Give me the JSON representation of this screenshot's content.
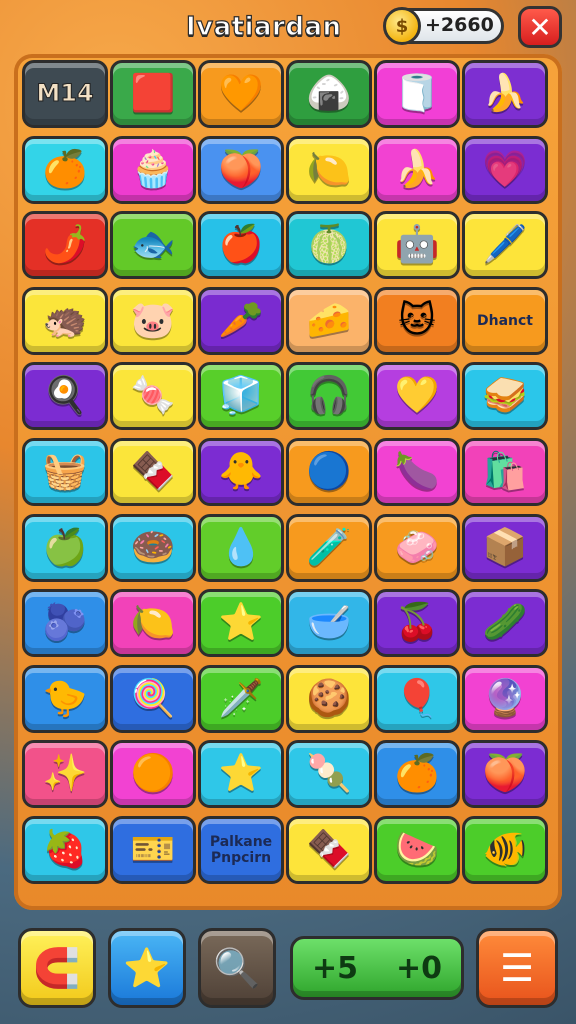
{
  "header": {
    "title": "Ivatiardan",
    "coins": "+2660",
    "coin_symbol": "$",
    "close_symbol": "✕"
  },
  "colors": {
    "board": "#f09a35",
    "close": "#e0302a",
    "score": "#3cb83a"
  },
  "tiles": [
    {
      "bg": "#3e4a52",
      "icon": "",
      "text": "M14",
      "big": true,
      "name": "tile-label-m14"
    },
    {
      "bg": "#3aa94a",
      "icon": "🟥",
      "name": "tile-flag"
    },
    {
      "bg": "#f79a1e",
      "icon": "🧡",
      "name": "tile-heart"
    },
    {
      "bg": "#2f9e3f",
      "icon": "🍙",
      "name": "tile-food"
    },
    {
      "bg": "#f23fd6",
      "icon": "🧻",
      "name": "tile-box"
    },
    {
      "bg": "#7d2fd1",
      "icon": "🍌",
      "name": "tile-banana"
    },
    {
      "bg": "#33d4e8",
      "icon": "🍊",
      "name": "tile-orange"
    },
    {
      "bg": "#ee3ccf",
      "icon": "🧁",
      "name": "tile-cup"
    },
    {
      "bg": "#4a92f0",
      "icon": "🍑",
      "name": "tile-plum"
    },
    {
      "bg": "#fde53b",
      "icon": "🍋",
      "name": "tile-lemon"
    },
    {
      "bg": "#f242d2",
      "icon": "🍌",
      "name": "tile-bananas"
    },
    {
      "bg": "#7b2dd2",
      "icon": "💗",
      "name": "tile-heart-pink"
    },
    {
      "bg": "#e43026",
      "icon": "🌶️",
      "name": "tile-pepper"
    },
    {
      "bg": "#63c928",
      "icon": "🐟",
      "name": "tile-fish"
    },
    {
      "bg": "#27c1e8",
      "icon": "🍎",
      "name": "tile-apple"
    },
    {
      "bg": "#20c7d4",
      "icon": "🍈",
      "name": "tile-melon"
    },
    {
      "bg": "#fde43a",
      "icon": "🤖",
      "name": "tile-robot"
    },
    {
      "bg": "#fde43a",
      "icon": "🖊️",
      "name": "tile-pen"
    },
    {
      "bg": "#fbe53a",
      "icon": "🦔",
      "name": "tile-hedgehog"
    },
    {
      "bg": "#fbe53a",
      "icon": "🐷",
      "name": "tile-pig"
    },
    {
      "bg": "#7a2bd0",
      "icon": "🥕",
      "name": "tile-carrot"
    },
    {
      "bg": "#fbb36a",
      "icon": "🧀",
      "name": "tile-cheese"
    },
    {
      "bg": "#f27f20",
      "icon": "🐱",
      "name": "tile-cat"
    },
    {
      "bg": "#f79a1e",
      "icon": "",
      "text": "Dhanct",
      "name": "tile-bag"
    },
    {
      "bg": "#7c2cd2",
      "icon": "🍳",
      "name": "tile-pan"
    },
    {
      "bg": "#fbe53a",
      "icon": "🍬",
      "name": "tile-candy"
    },
    {
      "bg": "#58cf2a",
      "icon": "🧊",
      "name": "tile-cube"
    },
    {
      "bg": "#42c936",
      "icon": "🎧",
      "name": "tile-headphones"
    },
    {
      "bg": "#b53ee0",
      "icon": "💛",
      "name": "tile-heart-lolly"
    },
    {
      "bg": "#2bc6ea",
      "icon": "🥪",
      "name": "tile-sandwich"
    },
    {
      "bg": "#2cc5e8",
      "icon": "🧺",
      "name": "tile-basket"
    },
    {
      "bg": "#fbe53a",
      "icon": "🍫",
      "name": "tile-chocolate"
    },
    {
      "bg": "#7c2cd2",
      "icon": "🐥",
      "name": "tile-chick"
    },
    {
      "bg": "#f79a1e",
      "icon": "🔵",
      "name": "tile-ball"
    },
    {
      "bg": "#f242d2",
      "icon": "🍆",
      "name": "tile-eggplant"
    },
    {
      "bg": "#f242b9",
      "icon": "🛍️",
      "name": "tile-shopping"
    },
    {
      "bg": "#2fc7e8",
      "icon": "🍏",
      "name": "tile-green-apple"
    },
    {
      "bg": "#2cc5e8",
      "icon": "🍩",
      "name": "tile-donut"
    },
    {
      "bg": "#62cd2a",
      "icon": "💧",
      "name": "tile-drop"
    },
    {
      "bg": "#f79a1e",
      "icon": "🧪",
      "name": "tile-molecule"
    },
    {
      "bg": "#f79a1e",
      "icon": "🧼",
      "name": "tile-soap"
    },
    {
      "bg": "#7c2cd2",
      "icon": "📦",
      "name": "tile-crate"
    },
    {
      "bg": "#2f8fe8",
      "icon": "🫐",
      "name": "tile-berry"
    },
    {
      "bg": "#f242b9",
      "icon": "🍋",
      "name": "tile-lemon-2"
    },
    {
      "bg": "#4ccd2a",
      "icon": "⭐",
      "name": "tile-wand"
    },
    {
      "bg": "#32b6e8",
      "icon": "🥣",
      "name": "tile-bowl"
    },
    {
      "bg": "#7c2cd2",
      "icon": "🍒",
      "name": "tile-cherry"
    },
    {
      "bg": "#7c2cd2",
      "icon": "🥒",
      "name": "tile-cucumber"
    },
    {
      "bg": "#2f8fe8",
      "icon": "🐤",
      "name": "tile-bird"
    },
    {
      "bg": "#2f6ee0",
      "icon": "🍭",
      "name": "tile-stick"
    },
    {
      "bg": "#4ccd2a",
      "icon": "🗡️",
      "name": "tile-arrow"
    },
    {
      "bg": "#fde43a",
      "icon": "🍪",
      "name": "tile-cookie"
    },
    {
      "bg": "#2fc7e8",
      "icon": "🎈",
      "name": "tile-balloon"
    },
    {
      "bg": "#f242d2",
      "icon": "🔮",
      "name": "tile-orb"
    },
    {
      "bg": "#f2528a",
      "icon": "✨",
      "name": "tile-sparkle"
    },
    {
      "bg": "#f242d2",
      "icon": "🟠",
      "name": "tile-orange-ball"
    },
    {
      "bg": "#2fc7e8",
      "icon": "⭐",
      "name": "tile-star"
    },
    {
      "bg": "#2fc7e8",
      "icon": "🍡",
      "name": "tile-lollipop"
    },
    {
      "bg": "#2f8fe8",
      "icon": "🍊",
      "name": "tile-tangerine"
    },
    {
      "bg": "#7c2cd2",
      "icon": "🍑",
      "name": "tile-peach"
    },
    {
      "bg": "#2fc7e8",
      "icon": "🍓",
      "name": "tile-fruit"
    },
    {
      "bg": "#2f6ee0",
      "icon": "🎫",
      "name": "tile-ticket"
    },
    {
      "bg": "#2f6ee0",
      "icon": "",
      "text": "Palkane\nPnpcirn",
      "name": "tile-text"
    },
    {
      "bg": "#fde43a",
      "icon": "🍫",
      "name": "tile-bar"
    },
    {
      "bg": "#4ccd2a",
      "icon": "🍉",
      "name": "tile-ball-red"
    },
    {
      "bg": "#4ccd2a",
      "icon": "🐠",
      "name": "tile-fish-orange"
    }
  ],
  "bottom": {
    "score_left": "+5",
    "score_right": "+0"
  }
}
